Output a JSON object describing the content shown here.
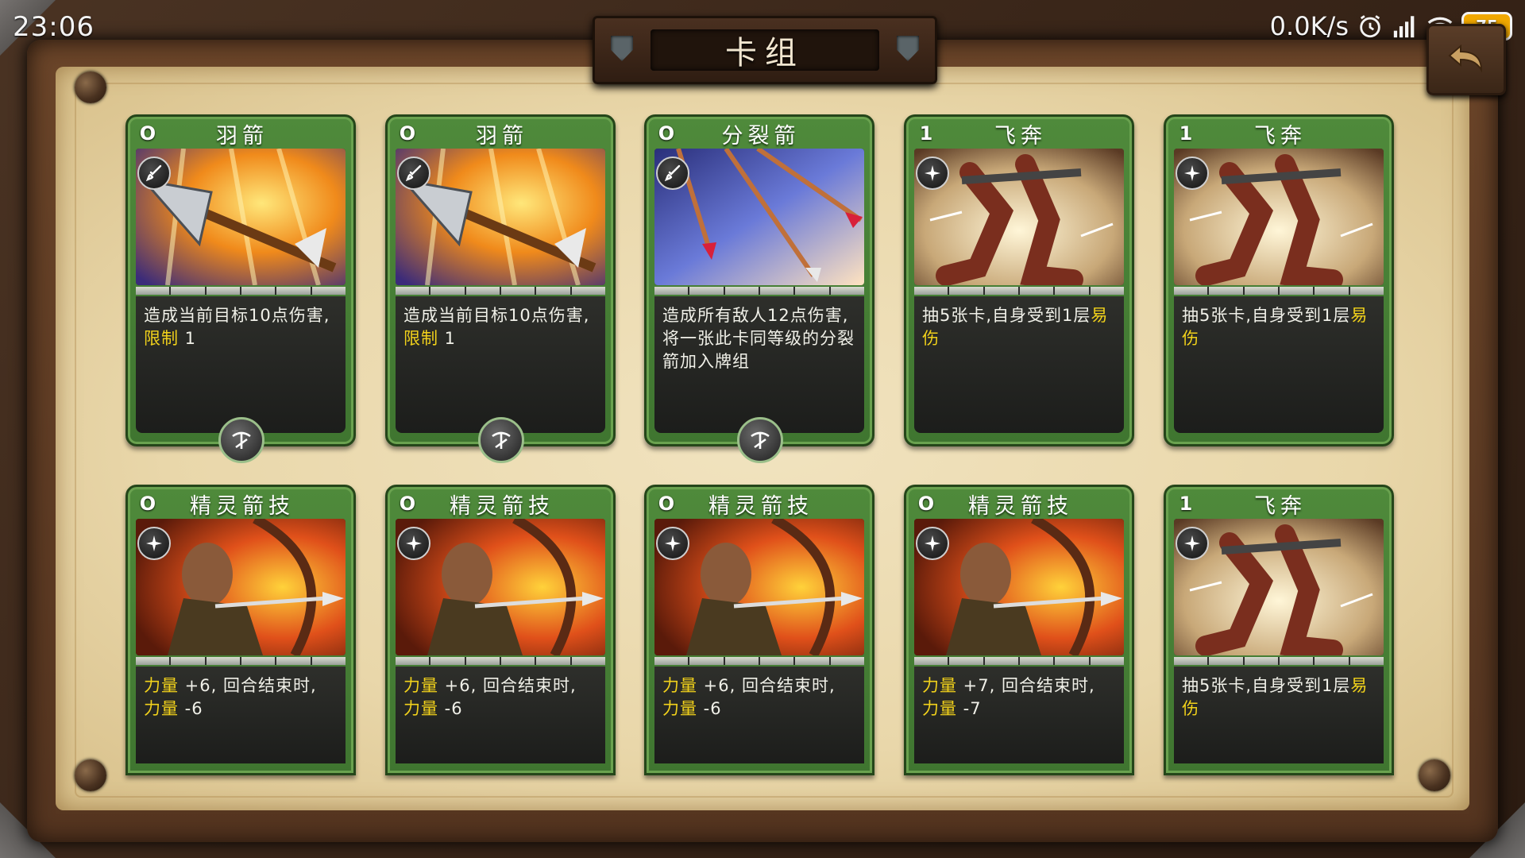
{
  "status_bar": {
    "time": "23:06",
    "net_speed": "0.0K/s",
    "battery": "75",
    "icons": [
      "alarm-icon",
      "signal-icon",
      "wifi-icon",
      "battery-icon"
    ]
  },
  "header": {
    "title": "卡组"
  },
  "colors": {
    "card_green": "#4f8a3b",
    "keyword_yellow": "#f2d21b",
    "card_body": "#1c1d1b",
    "parchment": "#e9d7aa"
  },
  "cards": [
    {
      "cost": "O",
      "name": "羽箭",
      "art": "arrow-art",
      "type_icon": "sword-icon",
      "class_icon": "crossbow-icon",
      "text": [
        {
          "t": "造成当前目标10点伤害,"
        },
        {
          "t": "限制",
          "kw": true
        },
        {
          "t": " 1"
        }
      ]
    },
    {
      "cost": "O",
      "name": "羽箭",
      "art": "arrow-art",
      "type_icon": "sword-icon",
      "class_icon": "crossbow-icon",
      "text": [
        {
          "t": "造成当前目标10点伤害,"
        },
        {
          "t": "限制",
          "kw": true
        },
        {
          "t": " 1"
        }
      ]
    },
    {
      "cost": "O",
      "name": "分裂箭",
      "art": "split-arrow-art",
      "type_icon": "sword-icon",
      "class_icon": "crossbow-icon",
      "text": [
        {
          "t": "造成所有敌人12点伤害, 将一张此卡同等级的分裂箭加入牌组"
        }
      ]
    },
    {
      "cost": "1",
      "name": "飞奔",
      "art": "sprint-art",
      "type_icon": "sparkle-icon",
      "class_icon": "",
      "text": [
        {
          "t": "抽5张卡,自身受到1层"
        },
        {
          "t": "易伤",
          "kw": true
        }
      ]
    },
    {
      "cost": "1",
      "name": "飞奔",
      "art": "sprint-art",
      "type_icon": "sparkle-icon",
      "class_icon": "",
      "text": [
        {
          "t": "抽5张卡,自身受到1层"
        },
        {
          "t": "易伤",
          "kw": true
        }
      ]
    },
    {
      "cost": "O",
      "name": "精灵箭技",
      "art": "archer-art",
      "type_icon": "sparkle-icon",
      "class_icon": "",
      "text": [
        {
          "t": "力量",
          "kw": true
        },
        {
          "t": " +6, 回合结束时, "
        },
        {
          "t": "力量",
          "kw": true
        },
        {
          "t": " -6"
        }
      ]
    },
    {
      "cost": "O",
      "name": "精灵箭技",
      "art": "archer-art",
      "type_icon": "sparkle-icon",
      "class_icon": "",
      "text": [
        {
          "t": "力量",
          "kw": true
        },
        {
          "t": " +6, 回合结束时, "
        },
        {
          "t": "力量",
          "kw": true
        },
        {
          "t": " -6"
        }
      ]
    },
    {
      "cost": "O",
      "name": "精灵箭技",
      "art": "archer-art",
      "type_icon": "sparkle-icon",
      "class_icon": "",
      "text": [
        {
          "t": "力量",
          "kw": true
        },
        {
          "t": " +6, 回合结束时, "
        },
        {
          "t": "力量",
          "kw": true
        },
        {
          "t": " -6"
        }
      ]
    },
    {
      "cost": "O",
      "name": "精灵箭技",
      "art": "archer-art",
      "type_icon": "sparkle-icon",
      "class_icon": "",
      "text": [
        {
          "t": "力量",
          "kw": true
        },
        {
          "t": " +7, 回合结束时, "
        },
        {
          "t": "力量",
          "kw": true
        },
        {
          "t": " -7"
        }
      ]
    },
    {
      "cost": "1",
      "name": "飞奔",
      "art": "sprint-art",
      "type_icon": "sparkle-icon",
      "class_icon": "",
      "text": [
        {
          "t": "抽5张卡,自身受到1层"
        },
        {
          "t": "易伤",
          "kw": true
        }
      ]
    }
  ]
}
